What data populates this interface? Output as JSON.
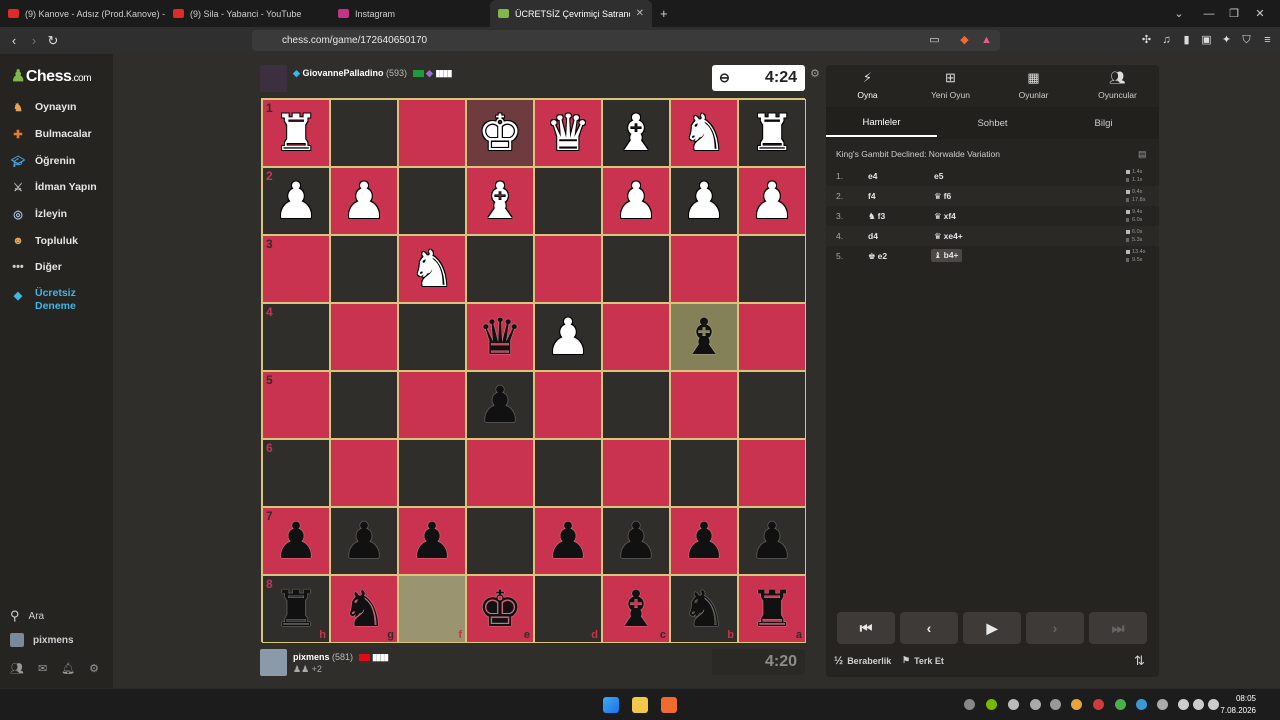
{
  "browser": {
    "tabs": [
      {
        "title": "(9) Kanove - Adsız (Prod.Kanove) - Yo",
        "icon_color": "#e02a2a"
      },
      {
        "title": "(9) Sila - Yabanci - YouTube",
        "icon_color": "#e02a2a"
      },
      {
        "title": "Instagram",
        "icon_color": "#c13584"
      },
      {
        "title": "ÜCRETSİZ Çevrimiçi Satranç Oyna",
        "icon_color": "#81b64c",
        "active": true
      }
    ],
    "new_tab": "+",
    "url": "chess.com/game/172640650170"
  },
  "sidebar": {
    "logo_main": "Chess",
    "logo_suffix": ".com",
    "items": [
      {
        "label": "Oynayın",
        "icon": "play-icon",
        "color": "#e6a15c"
      },
      {
        "label": "Bulmacalar",
        "icon": "puzzle-icon",
        "color": "#e07b3a"
      },
      {
        "label": "Öğrenin",
        "icon": "learn-icon",
        "color": "#4a9fd8"
      },
      {
        "label": "İdman Yapın",
        "icon": "train-icon",
        "color": "#bbbbbb"
      },
      {
        "label": "İzleyin",
        "icon": "watch-icon",
        "color": "#a0c0e0"
      },
      {
        "label": "Topluluk",
        "icon": "community-icon",
        "color": "#e6a15c"
      },
      {
        "label": "Diğer",
        "icon": "more-icon",
        "color": "#cccccc"
      },
      {
        "label": "Ücretsiz Deneme",
        "icon": "diamond-icon",
        "color": "#3fb6e8",
        "highlight": true
      }
    ],
    "search_label": "Ara",
    "user_label": "pixmens"
  },
  "game": {
    "top_player": {
      "name": "GiovannePalladino",
      "rating": "(593)",
      "clock": "4:24"
    },
    "bottom_player": {
      "name": "pixmens",
      "rating": "(581)",
      "clock": "4:20",
      "extra": "+2"
    },
    "ranks": [
      "1",
      "2",
      "3",
      "4",
      "5",
      "6",
      "7",
      "8"
    ],
    "files": [
      "h",
      "g",
      "f",
      "e",
      "d",
      "c",
      "b",
      "a"
    ],
    "board": [
      [
        "wR",
        "",
        "",
        "wK",
        "wQ",
        "wB",
        "wN",
        "wR"
      ],
      [
        "wP",
        "wP",
        "",
        "wB",
        "",
        "wP",
        "wP",
        "wP"
      ],
      [
        "",
        "",
        "wN",
        "",
        "",
        "",
        "",
        ""
      ],
      [
        "",
        "",
        "",
        "bQ",
        "wP",
        "",
        "bB",
        ""
      ],
      [
        "",
        "",
        "",
        "bP",
        "",
        "",
        "",
        ""
      ],
      [
        "",
        "",
        "",
        "",
        "",
        "",
        "",
        ""
      ],
      [
        "bP",
        "bP",
        "bP",
        "",
        "bP",
        "bP",
        "bP",
        "bP"
      ],
      [
        "bR",
        "bN",
        "",
        "bK",
        "",
        "bB",
        "bN",
        "bR"
      ]
    ]
  },
  "panel": {
    "tabs": [
      {
        "label": "Oyna",
        "icon": "bolt-icon"
      },
      {
        "label": "Yeni Oyun",
        "icon": "plus-icon"
      },
      {
        "label": "Oyunlar",
        "icon": "board-icon"
      },
      {
        "label": "Oyuncular",
        "icon": "players-icon"
      }
    ],
    "subtabs": [
      "Hamleler",
      "Sohbet",
      "Bilgi"
    ],
    "opening": "King's Gambit Declined: Norwalde Variation",
    "moves": [
      {
        "num": "1.",
        "white": "e4",
        "black": "e5",
        "wt": "1.4s",
        "bt": "1.1s"
      },
      {
        "num": "2.",
        "white": "f4",
        "black": "f6",
        "wt": "0.4s",
        "bt": "17.8s",
        "black_icon": "♛"
      },
      {
        "num": "3.",
        "white": "f3",
        "black": "xf4",
        "wt": "9.4s",
        "bt": "6.0s",
        "white_icon": "♞",
        "black_icon": "♛"
      },
      {
        "num": "4.",
        "white": "d4",
        "black": "xe4+",
        "wt": "6.0s",
        "bt": "5.3s",
        "black_icon": "♛"
      },
      {
        "num": "5.",
        "white": "e2",
        "black": "b4+",
        "wt": "13.4s",
        "bt": "9.5s",
        "white_icon": "♚",
        "black_icon": "♝",
        "current": true
      }
    ],
    "nav_buttons": [
      "⏮",
      "‹",
      "▶",
      "›",
      "⏭"
    ],
    "draw_label": "Beraberlik",
    "resign_label": "Terk Et"
  },
  "taskbar": {
    "time": "08:05",
    "date": "7.08.2026"
  }
}
